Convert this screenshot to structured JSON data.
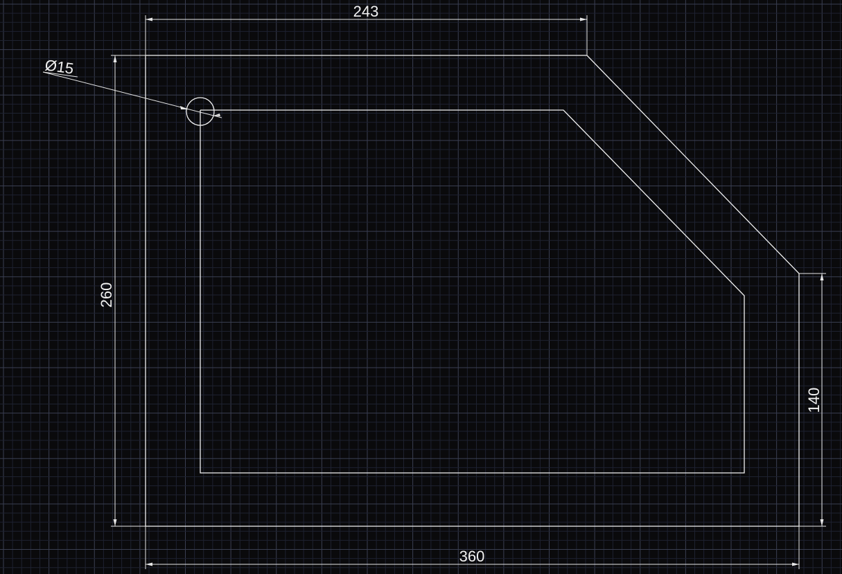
{
  "canvas": {
    "background": "#0a0a0c",
    "grid_minor_color": "#1e2230",
    "grid_major_color": "#3a3f52",
    "geometry_color": "#f2f2f2"
  },
  "dimensions": {
    "top_width": "243",
    "bottom_width": "360",
    "left_height": "260",
    "right_height": "140",
    "hole_diameter": "Ø15"
  }
}
